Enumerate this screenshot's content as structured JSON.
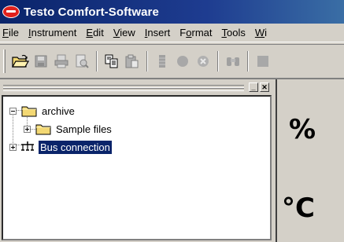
{
  "window": {
    "title": "Testo Comfort-Software",
    "logo": "testo-logo-icon"
  },
  "menubar": {
    "items": [
      {
        "accel": "F",
        "rest": "ile"
      },
      {
        "accel": "I",
        "rest": "nstrument"
      },
      {
        "accel": "E",
        "rest": "dit"
      },
      {
        "accel": "V",
        "rest": "iew"
      },
      {
        "accel": "I",
        "rest": "nsert"
      },
      {
        "pre": "F",
        "accel": "o",
        "rest": "rmat"
      },
      {
        "accel": "T",
        "rest": "ools"
      },
      {
        "accel": "W",
        "rest": "i"
      }
    ]
  },
  "toolbar": {
    "buttons": [
      "open-folder-icon",
      "save-icon",
      "print-icon",
      "print-preview-icon",
      "copy-icon",
      "paste-icon",
      "column-icon",
      "record-icon",
      "stop-icon",
      "binoculars-icon",
      "more-icon"
    ]
  },
  "tree": {
    "items": [
      {
        "label": "archive",
        "icon": "folder-icon",
        "expander": "minus"
      },
      {
        "label": "Sample files",
        "icon": "folder-icon",
        "expander": "plus"
      },
      {
        "label": "Bus connection",
        "icon": "bus-connection-icon",
        "expander": "plus",
        "selected": true
      }
    ]
  },
  "side_panel": {
    "unit_percent": "%",
    "unit_celsius": "°C"
  }
}
